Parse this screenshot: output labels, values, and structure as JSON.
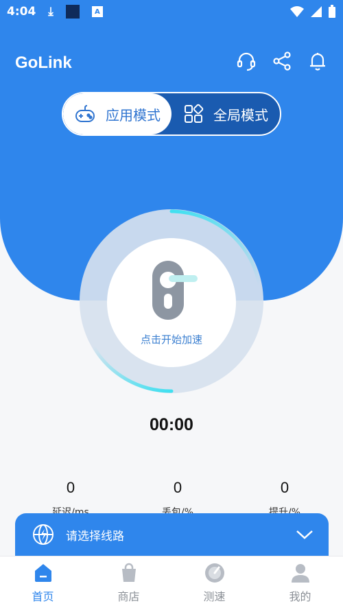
{
  "status_bar": {
    "time": "4:04",
    "a_icon_text": "A"
  },
  "header": {
    "title": "GoLink",
    "icons": [
      "headset-icon",
      "share-icon",
      "bell-icon"
    ]
  },
  "mode_toggle": {
    "app_mode_label": "应用模式",
    "global_mode_label": "全局模式",
    "selected": "应用模式"
  },
  "dial": {
    "label": "点击开始加速"
  },
  "timer": "00:00",
  "stats": [
    {
      "value": "0",
      "label": "延迟/ms"
    },
    {
      "value": "0",
      "label": "丢包/%"
    },
    {
      "value": "0",
      "label": "提升/%"
    }
  ],
  "route": {
    "placeholder": "请选择线路"
  },
  "bottom_nav": [
    {
      "label": "首页",
      "icon": "home-icon",
      "active": true
    },
    {
      "label": "商店",
      "icon": "shop-bag-icon",
      "active": false
    },
    {
      "label": "测速",
      "icon": "speedometer-icon",
      "active": false
    },
    {
      "label": "我的",
      "icon": "user-icon",
      "active": false
    }
  ],
  "colors": {
    "primary": "#2f86ec",
    "toggle_dark": "#1a5bb0",
    "accent_cyan": "#3fe0f0"
  }
}
